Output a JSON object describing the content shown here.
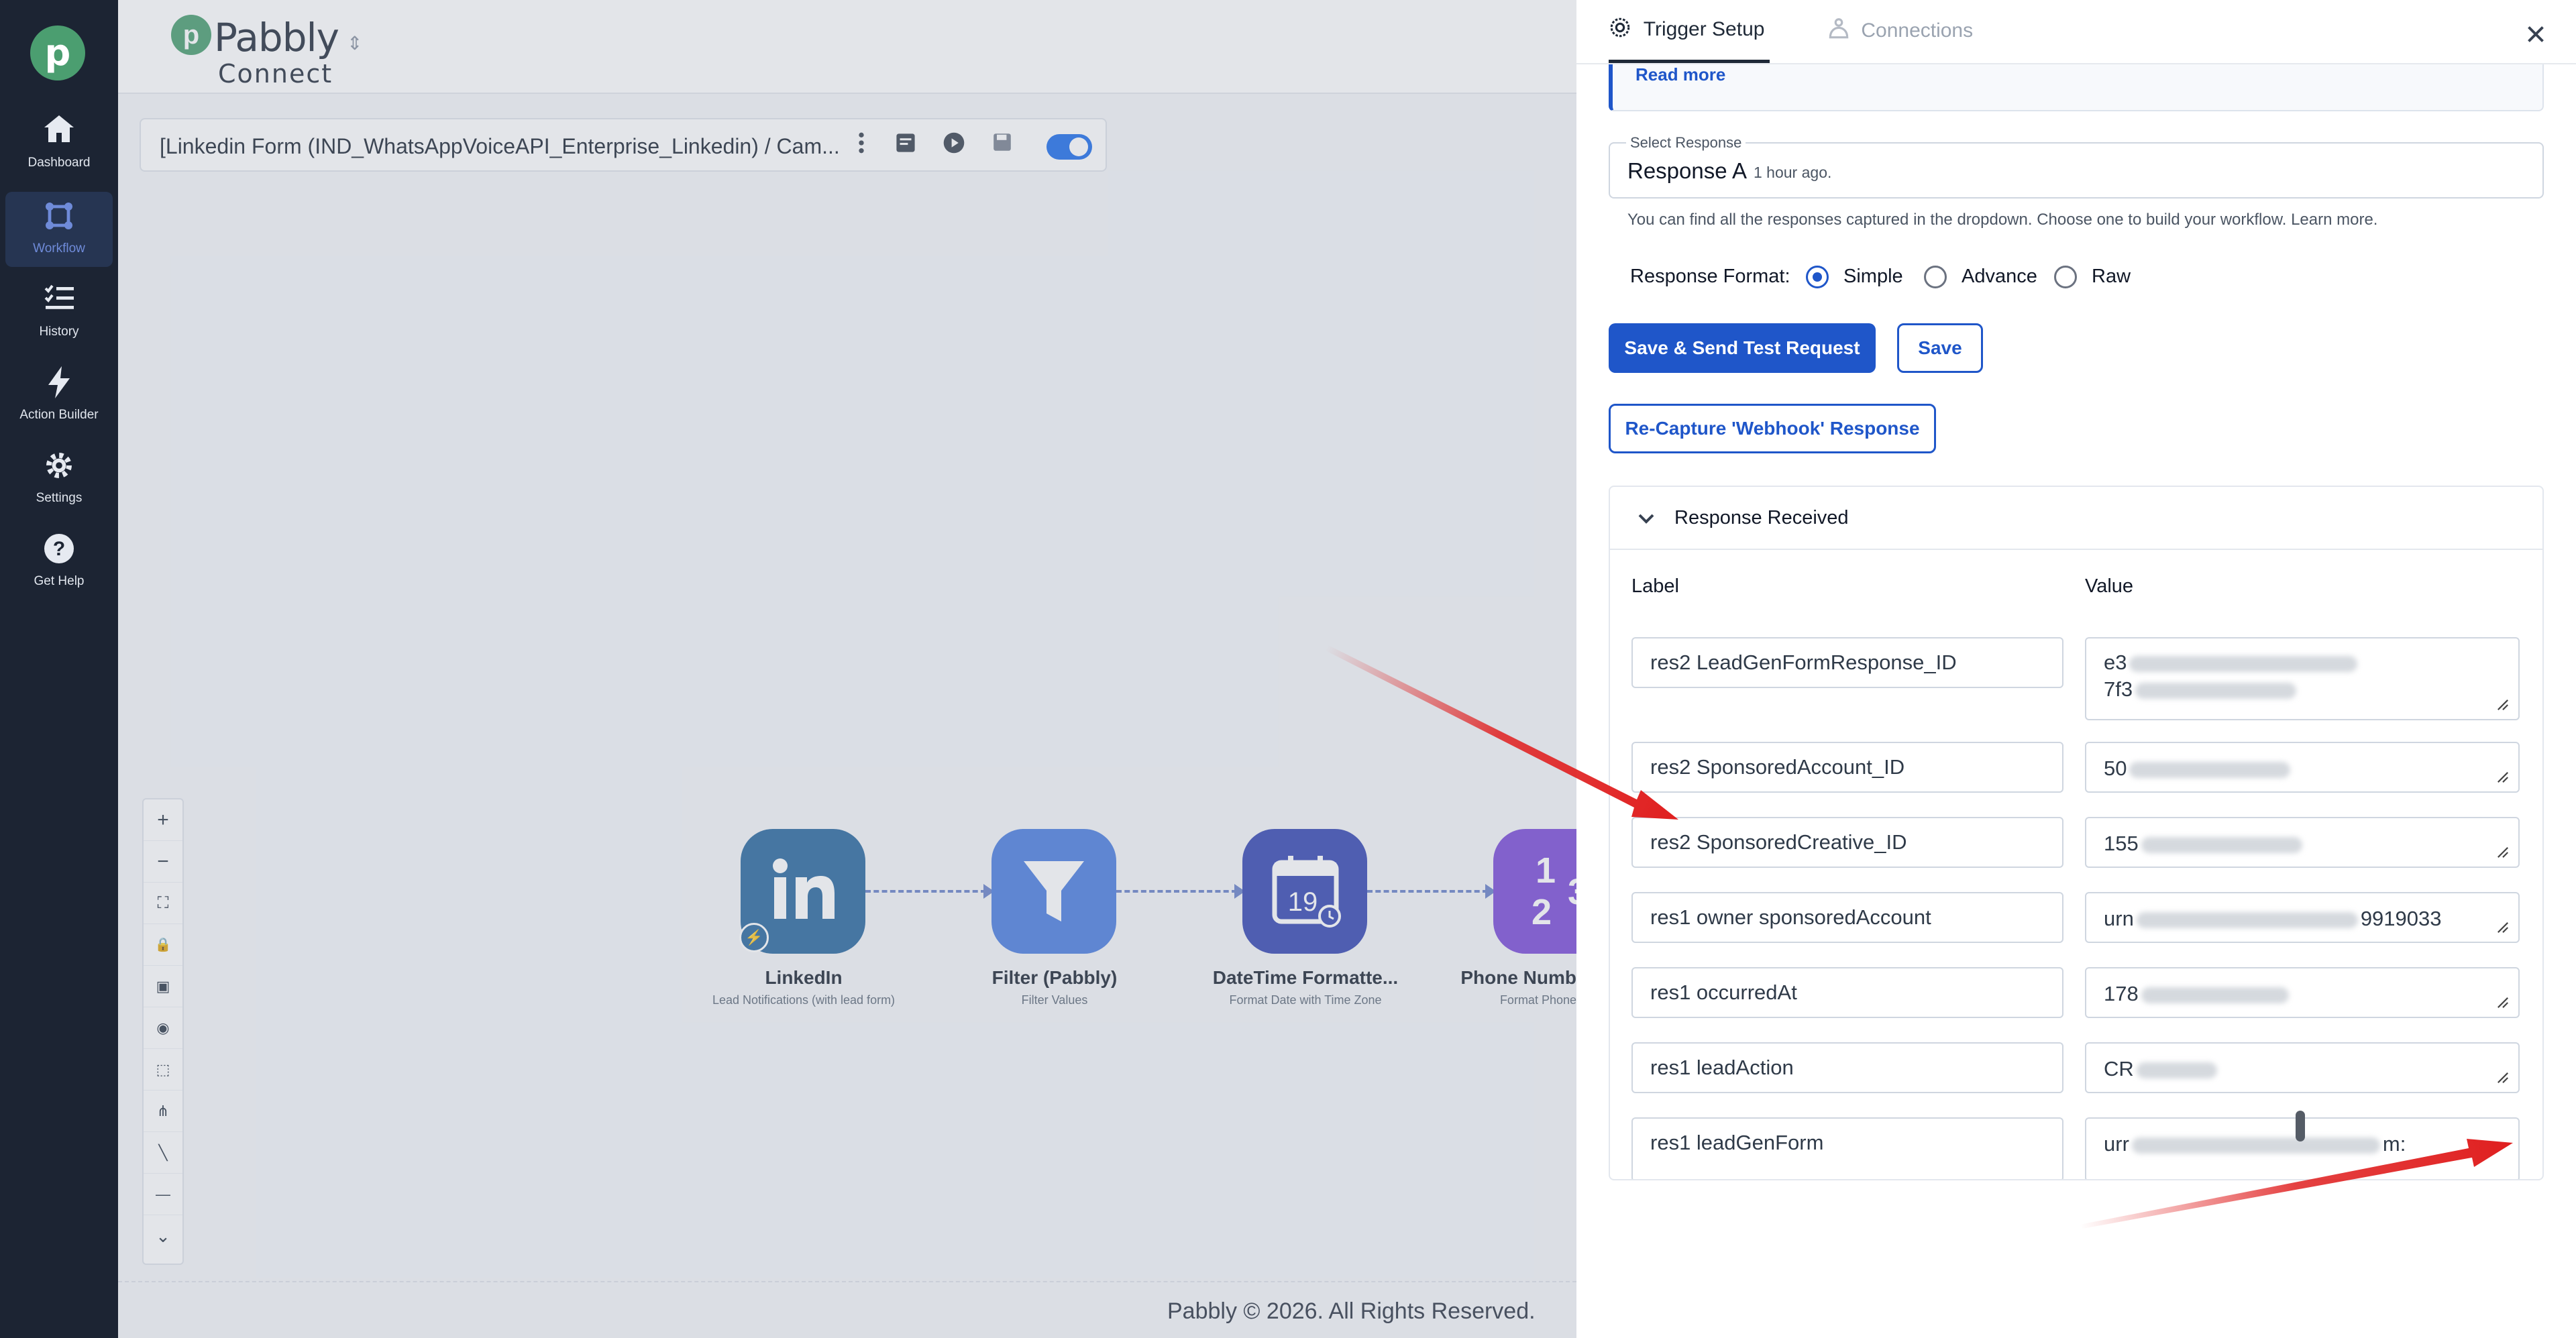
{
  "sidebar": {
    "items": [
      {
        "label": "Dashboard",
        "icon": "home-icon"
      },
      {
        "label": "Workflow",
        "icon": "workflow-icon",
        "active": true
      },
      {
        "label": "History",
        "icon": "history-icon"
      },
      {
        "label": "Action Builder",
        "icon": "bolt-icon"
      },
      {
        "label": "Settings",
        "icon": "gear-icon"
      },
      {
        "label": "Get Help",
        "icon": "help-icon"
      }
    ]
  },
  "brand": {
    "name": "Pabbly",
    "sub": "Connect"
  },
  "workflow": {
    "title": "[Linkedin Form (IND_WhatsAppVoiceAPI_Enterprise_Linkedin) / Cam...",
    "enabled": true,
    "zoom_controls": [
      "+",
      "−",
      "⛶",
      "🔒",
      "▣",
      "◉",
      "⬚",
      "⋔",
      "╲",
      "—",
      "⌄"
    ]
  },
  "nodes": [
    {
      "title": "LinkedIn",
      "subtitle": "Lead Notifications (with lead form)",
      "color": "#2c6aa0",
      "icon": "linkedin-icon"
    },
    {
      "title": "Filter (Pabbly)",
      "subtitle": "Filter Values",
      "color": "#4d7fe0",
      "icon": "filter-icon"
    },
    {
      "title": "DateTime Formatte...",
      "subtitle": "Format Date with Time Zone",
      "color": "#3849b4",
      "icon": "calendar-icon",
      "badge_text": "19"
    },
    {
      "title": "Phone Numb",
      "subtitle": "Format Phone",
      "color": "#7d4ed8",
      "icon": "numbers-icon",
      "badge_text": "123"
    }
  ],
  "footer": "Pabbly © 2026. All Rights Reserved.",
  "panel": {
    "tabs": [
      {
        "label": "Trigger Setup",
        "active": true
      },
      {
        "label": "Connections",
        "active": false
      }
    ],
    "read_more": "Read more",
    "select_legend": "Select Response",
    "select_value": "Response A",
    "select_time": "1 hour ago.",
    "hint": "You can find all the responses captured in the dropdown. Choose one to build your workflow. Learn more.",
    "format_label": "Response Format:",
    "formats": [
      {
        "label": "Simple",
        "checked": true
      },
      {
        "label": "Advance",
        "checked": false
      },
      {
        "label": "Raw",
        "checked": false
      }
    ],
    "save_send_label": "Save & Send Test Request",
    "save_label": "Save",
    "recapture_label": "Re-Capture 'Webhook' Response",
    "response_title": "Response Received",
    "col_label": "Label",
    "col_value": "Value",
    "rows": [
      {
        "label": "res2 LeadGenFormResponse_ID",
        "value_lines": [
          "e3",
          "7f3"
        ]
      },
      {
        "label": "res2 SponsoredAccount_ID",
        "value_lines": [
          "50"
        ]
      },
      {
        "label": "res2 SponsoredCreative_ID",
        "value_lines": [
          "155"
        ]
      },
      {
        "label": "res1 owner sponsoredAccount",
        "value_lines": [
          "urn",
          "9919033"
        ]
      },
      {
        "label": "res1 occurredAt",
        "value_lines": [
          "178"
        ]
      },
      {
        "label": "res1 leadAction",
        "value_lines": [
          "CR"
        ]
      },
      {
        "label": "res1 leadGenForm",
        "value_lines": [
          "urr",
          "m:"
        ]
      }
    ]
  },
  "colors": {
    "accent": "#1f56c9",
    "sidebar": "#1c2433",
    "arrow": "#e02020"
  }
}
